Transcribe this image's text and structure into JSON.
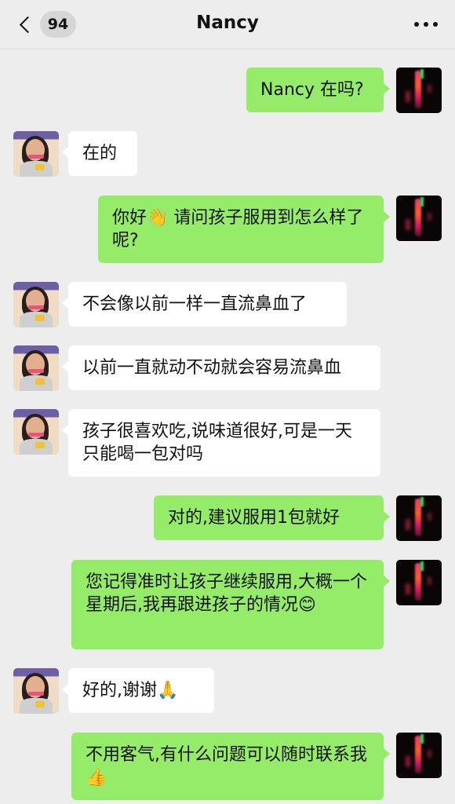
{
  "header": {
    "back_count": "94",
    "title": "Nancy",
    "icons": {
      "back": "chevron-left-icon",
      "more": "more-dots-icon"
    }
  },
  "colors": {
    "outgoing_bubble": "#95ec69",
    "incoming_bubble": "#ffffff",
    "background": "#ededed"
  },
  "messages": [
    {
      "sender": "me",
      "text": "Nancy 在吗?"
    },
    {
      "sender": "Nancy",
      "text": "在的"
    },
    {
      "sender": "me",
      "text": "你好👋 请问孩子服用到怎么样了呢?"
    },
    {
      "sender": "Nancy",
      "text": "不会像以前一样一直流鼻血了"
    },
    {
      "sender": "Nancy",
      "text": "以前一直就动不动就会容易流鼻血"
    },
    {
      "sender": "Nancy",
      "text": "孩子很喜欢吃,说味道很好,可是一天只能喝一包对吗"
    },
    {
      "sender": "me",
      "text": "对的,建议服用1包就好"
    },
    {
      "sender": "me",
      "text": "您记得准时让孩子继续服用,大概一个星期后,我再跟进孩子的情况😊"
    },
    {
      "sender": "Nancy",
      "text": "好的,谢谢🙏"
    },
    {
      "sender": "me",
      "text": "不用客气,有什么问题可以随时联系我 👍"
    }
  ]
}
